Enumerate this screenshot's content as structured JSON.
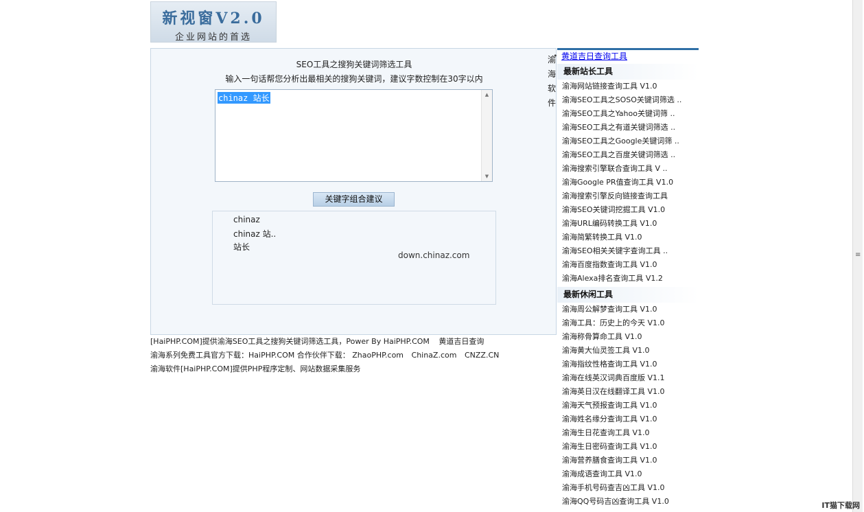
{
  "logo": {
    "title": "新视窗V2.0",
    "subtitle": "企业网站的首选"
  },
  "tool": {
    "title": "SEO工具之搜狗关键词筛选工具",
    "description": "输入一句话帮您分析出最相关的搜狗关键词，建议字数控制在30字以内",
    "input_value": "chinaz 站长",
    "button_label": "关键字组合建议",
    "results": [
      "chinaz",
      "chinaz 站..",
      "站长"
    ],
    "watermark": "down.chinaz.com"
  },
  "footer": {
    "line1": "[HaiPHP.COM]提供渝海SEO工具之搜狗关键词筛选工具，Power By HaiPHP.COM",
    "line1_link": "黄道吉日查询",
    "line2_prefix": "渝海系列免费工具官方下载：HaiPHP.COM  合作伙伴下载：",
    "partners": [
      "ZhaoPHP.com",
      "ChinaZ.com",
      "CNZZ.CN"
    ],
    "line3": "渝海软件[HaiPHP.COM]提供PHP程序定制、网站数据采集服务"
  },
  "clipped_text": [
    "渝",
    "海",
    "软",
    "件"
  ],
  "sidebar": {
    "history_item": "黄道吉日查询工具",
    "webmaster_header": "最新站长工具",
    "webmaster_items": [
      "渝海网站链接查询工具 V1.0",
      "渝海SEO工具之SOSO关键词筛选 ..",
      "渝海SEO工具之Yahoo关键词筛 ..",
      "渝海SEO工具之有道关键词筛选 ..",
      "渝海SEO工具之Google关键词筛 ..",
      "渝海SEO工具之百度关键词筛选 ..",
      "渝海搜索引擎联合查询工具 V ..",
      "渝海Google PR值查询工具 V1.0",
      "渝海搜索引擎反向链接查询工具",
      "渝海SEO关键词挖掘工具 V1.0",
      "渝海URL编码转换工具 V1.0",
      "渝海简繁转换工具 V1.0",
      "渝海SEO相关关键字查询工具 ..",
      "渝海百度指数查询工具 V1.0",
      "渝海Alexa排名查询工具 V1.2"
    ],
    "leisure_header": "最新休闲工具",
    "leisure_items": [
      "渝海周公解梦查询工具 V1.0",
      "渝海工具：历史上的今天 V1.0",
      "渝海称骨算命工具 V1.0",
      "渝海黄大仙灵签工具 V1.0",
      "渝海指纹性格查询工具 V1.0",
      "渝海在线英汉词典百度版 V1.1",
      "渝海英日汉在线翻译工具 V1.0",
      "渝海天气预报查询工具 V1.0",
      "渝海姓名缘分查询工具 V1.0",
      "渝海生日花查询工具 V1.0",
      "渝海生日密码查询工具 V1.0",
      "渝海营养膳食查询工具 V1.0",
      "渝海成语查询工具 V1.0",
      "渝海手机号码查吉凶工具 V1.0",
      "渝海QQ号码吉凶查询工具 V1.0"
    ]
  },
  "corner_watermark": "IT猫下载网"
}
